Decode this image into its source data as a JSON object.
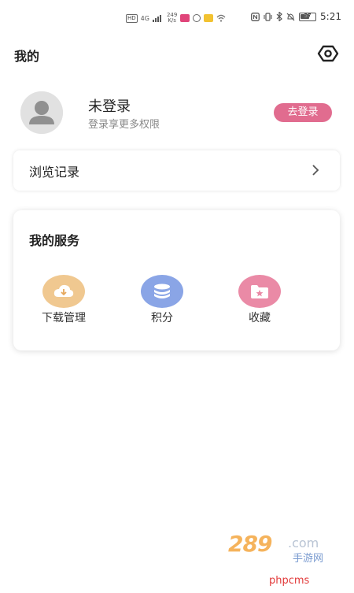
{
  "status_bar": {
    "hd": "HD",
    "network": "4G",
    "speed_value": "249",
    "speed_unit": "K/s",
    "battery": "57",
    "time": "5:21"
  },
  "header": {
    "title": "我的"
  },
  "user": {
    "name": "未登录",
    "hint": "登录享更多权限",
    "login_button": "去登录"
  },
  "history": {
    "label": "浏览记录"
  },
  "services": {
    "title": "我的服务",
    "items": [
      {
        "label": "下载管理",
        "icon": "download-cloud-icon",
        "color": "#f0c890"
      },
      {
        "label": "积分",
        "icon": "coin-stack-icon",
        "color": "#8aa5e6"
      },
      {
        "label": "收藏",
        "icon": "star-folder-icon",
        "color": "#ea8aa6"
      }
    ]
  },
  "colors": {
    "accent": "#e16c8f"
  },
  "watermark": {
    "logo": "289",
    "domain": ".com",
    "sub": "手游网",
    "tag": "phpcms"
  }
}
